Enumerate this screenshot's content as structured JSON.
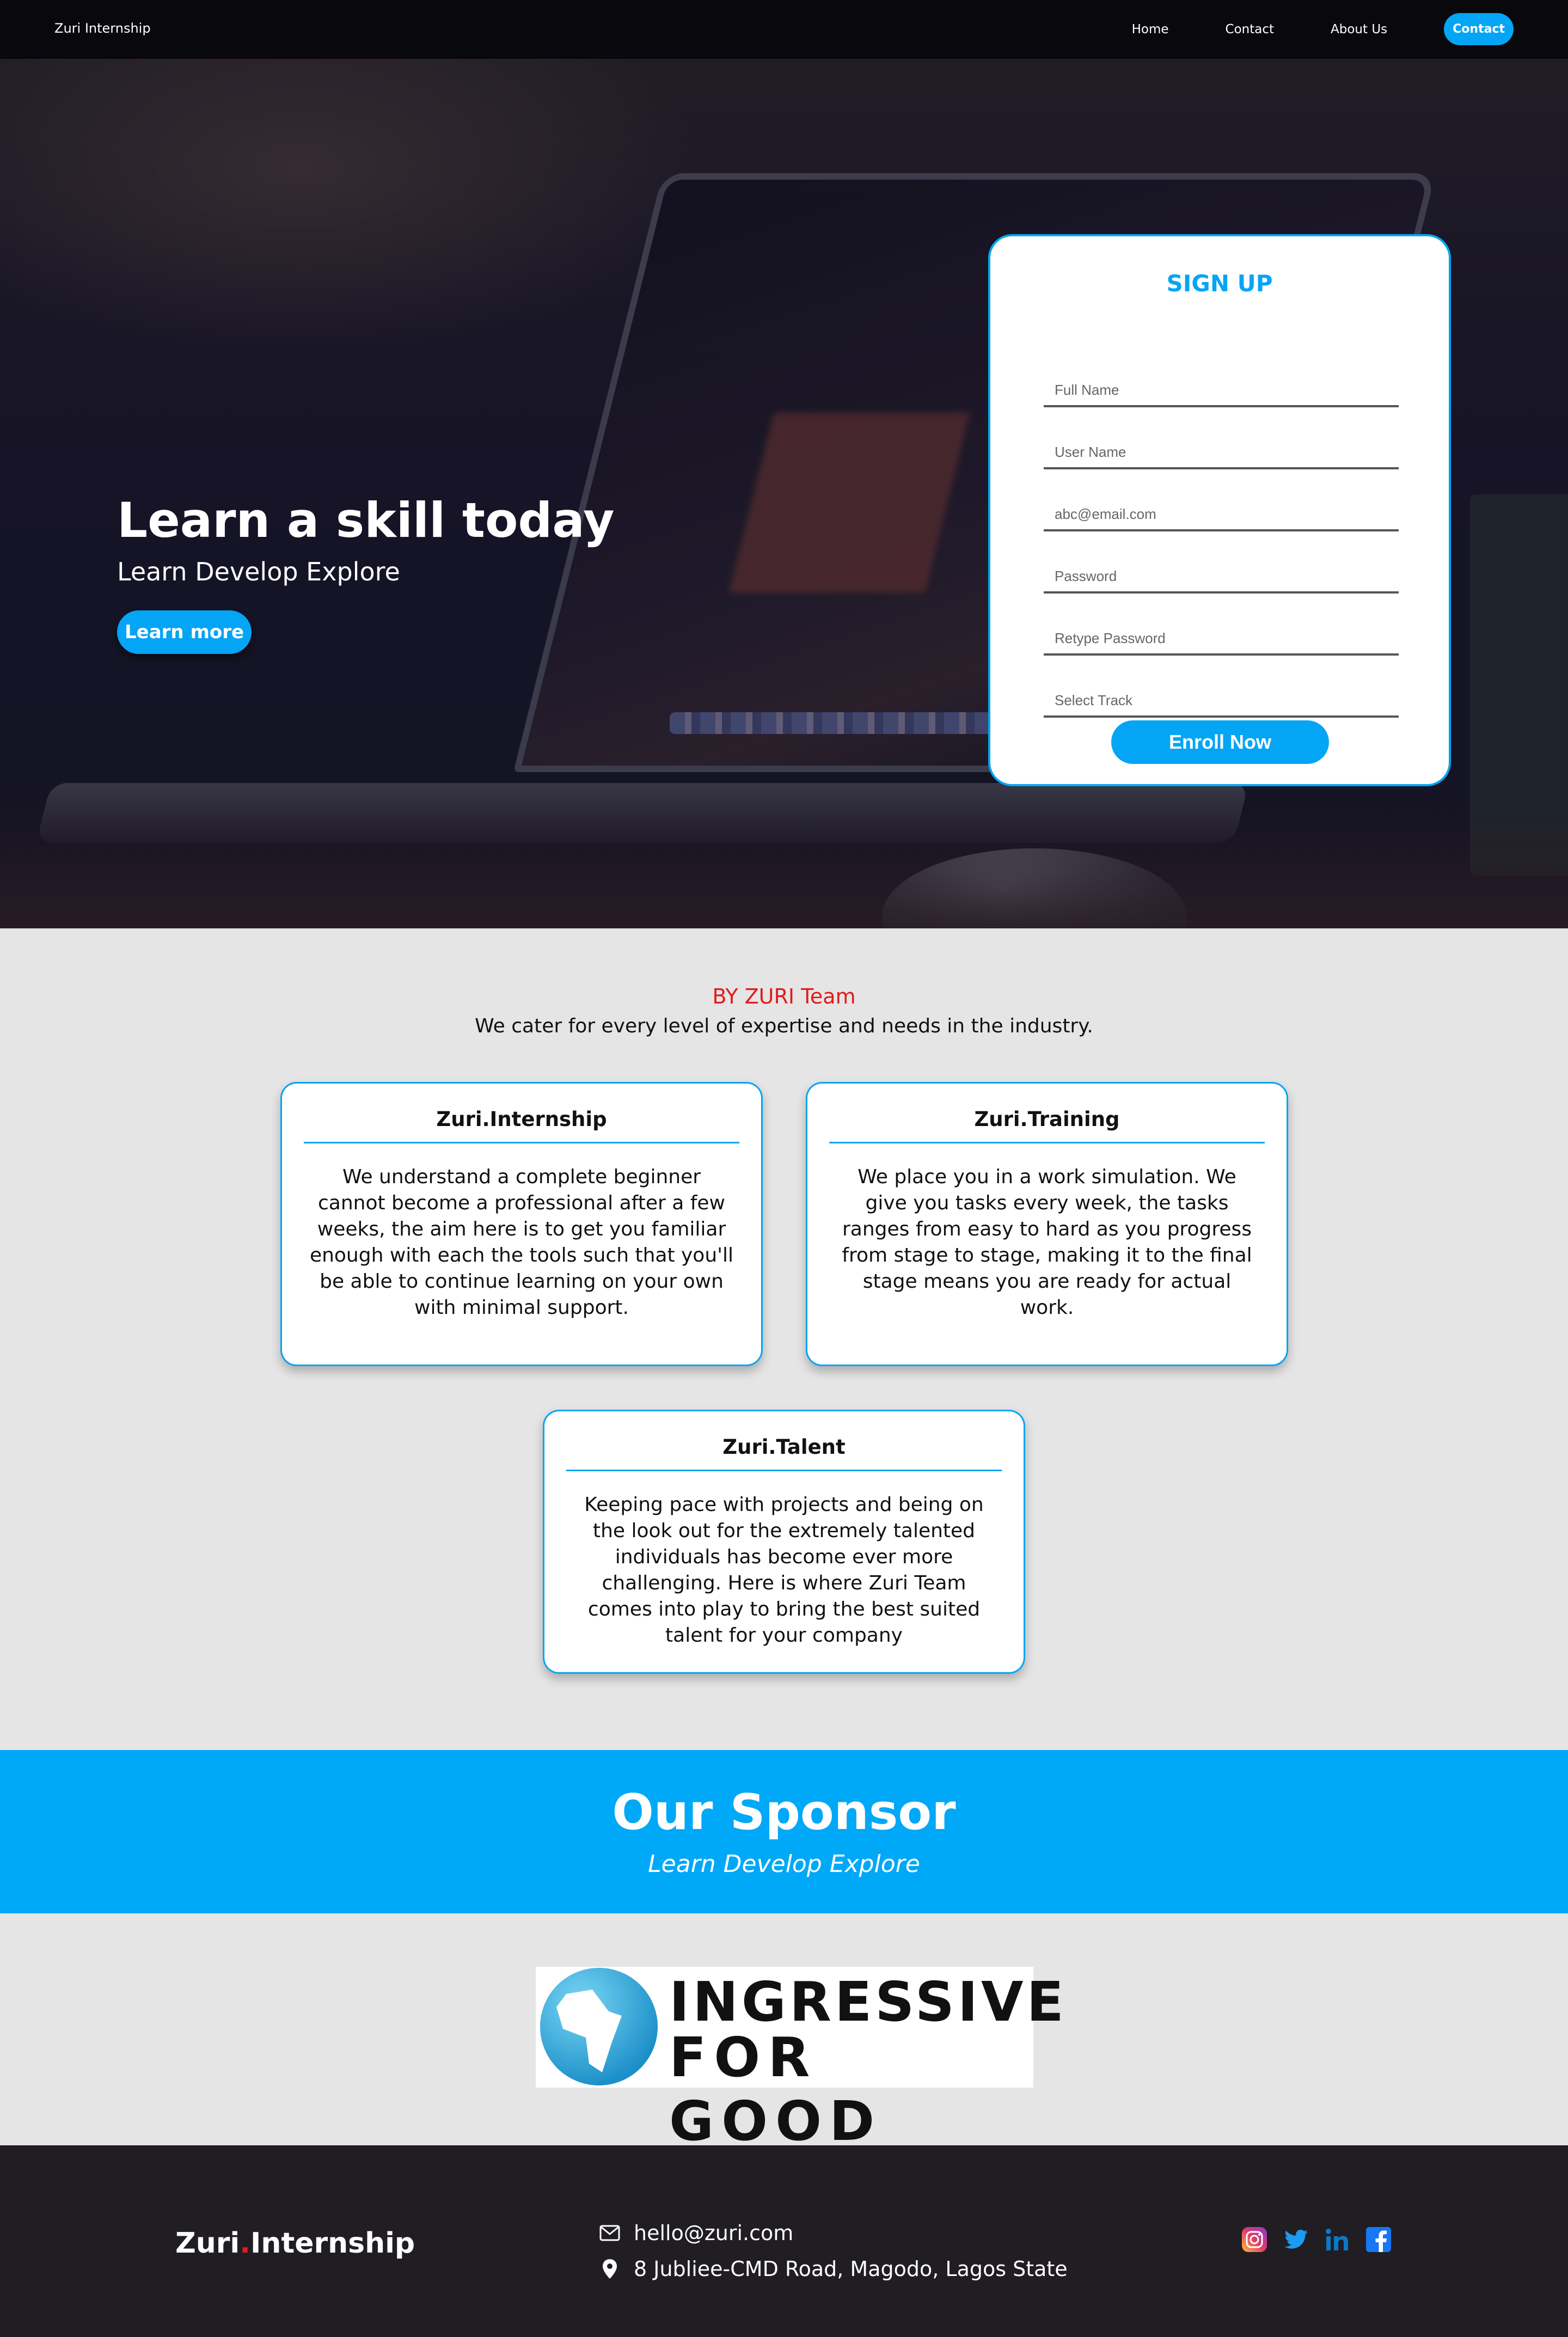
{
  "nav": {
    "brand": "Zuri Internship",
    "links": [
      "Home",
      "Contact",
      "About Us"
    ],
    "cta": "Contact"
  },
  "hero": {
    "title": "Learn a skill today",
    "subtitle": "Learn Develop Explore",
    "button": "Learn more"
  },
  "signup": {
    "title": "SIGN UP",
    "placeholders": {
      "full_name": "Full Name",
      "user_name": "User Name",
      "email": "abc@email.com",
      "password": "Password",
      "retype": "Retype Password",
      "track": "Select Track"
    },
    "button": "Enroll Now"
  },
  "services": {
    "by": "BY ZURI Team",
    "subtitle": "We cater for every level of expertise and needs in the industry.",
    "cards": [
      {
        "title": "Zuri.Internship",
        "text": "We understand a complete beginner cannot become a professional after a few weeks, the aim here is to get you familiar enough with each the tools such that you'll be able to continue learning on your own with minimal support."
      },
      {
        "title": "Zuri.Training",
        "text": "We place you in a work simulation. We give you tasks every week, the tasks ranges from easy to hard as you progress from stage to stage, making it to the final stage means you are ready for actual work."
      },
      {
        "title": "Zuri.Talent",
        "text": "Keeping pace with projects and being on the look out for the extremely talented individuals has become ever more challenging. Here is where Zuri Team comes into play to bring the best suited talent for your company"
      }
    ]
  },
  "sponsor": {
    "title": "Our Sponsor",
    "subtitle": "Learn Develop Explore",
    "logo_line1": "INGRESSIVE",
    "logo_line2": "FOR GOOD"
  },
  "footer": {
    "brand_a": "Zuri",
    "brand_dot": ".",
    "brand_b": "Internship",
    "email": "hello@zuri.com",
    "address": "8 Jubliee-CMD Road, Magodo, Lagos State",
    "social": [
      "instagram-icon",
      "twitter-icon",
      "linkedin-icon",
      "facebook-icon"
    ]
  },
  "colors": {
    "accent": "#04a5f4",
    "sponsor_bg": "#00a8f8",
    "highlight": "#e21a1a",
    "footer_bg": "#201d23",
    "nav_bg": "#09080c"
  }
}
